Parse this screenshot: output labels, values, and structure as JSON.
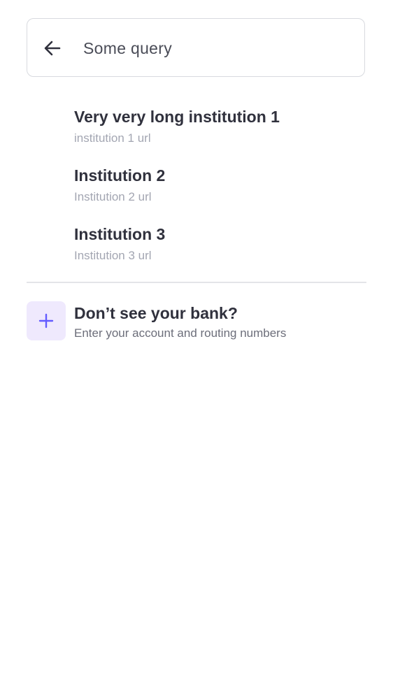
{
  "search": {
    "value": "Some query",
    "back_icon": "arrow-left-icon"
  },
  "results": [
    {
      "name": "Very very long institution 1",
      "url": "institution 1 url"
    },
    {
      "name": "Institution 2",
      "url": "Institution 2 url"
    },
    {
      "name": "Institution 3",
      "url": "Institution 3 url"
    }
  ],
  "manual_entry": {
    "icon": "plus-icon",
    "title": "Don’t see your bank?",
    "subtitle": "Enter your account and routing numbers"
  },
  "colors": {
    "accent": "#635bff",
    "accent_background": "#efe9fd",
    "primary_text": "#30313d",
    "secondary_text": "#a3a6b2",
    "divider": "#e3e4e8"
  }
}
